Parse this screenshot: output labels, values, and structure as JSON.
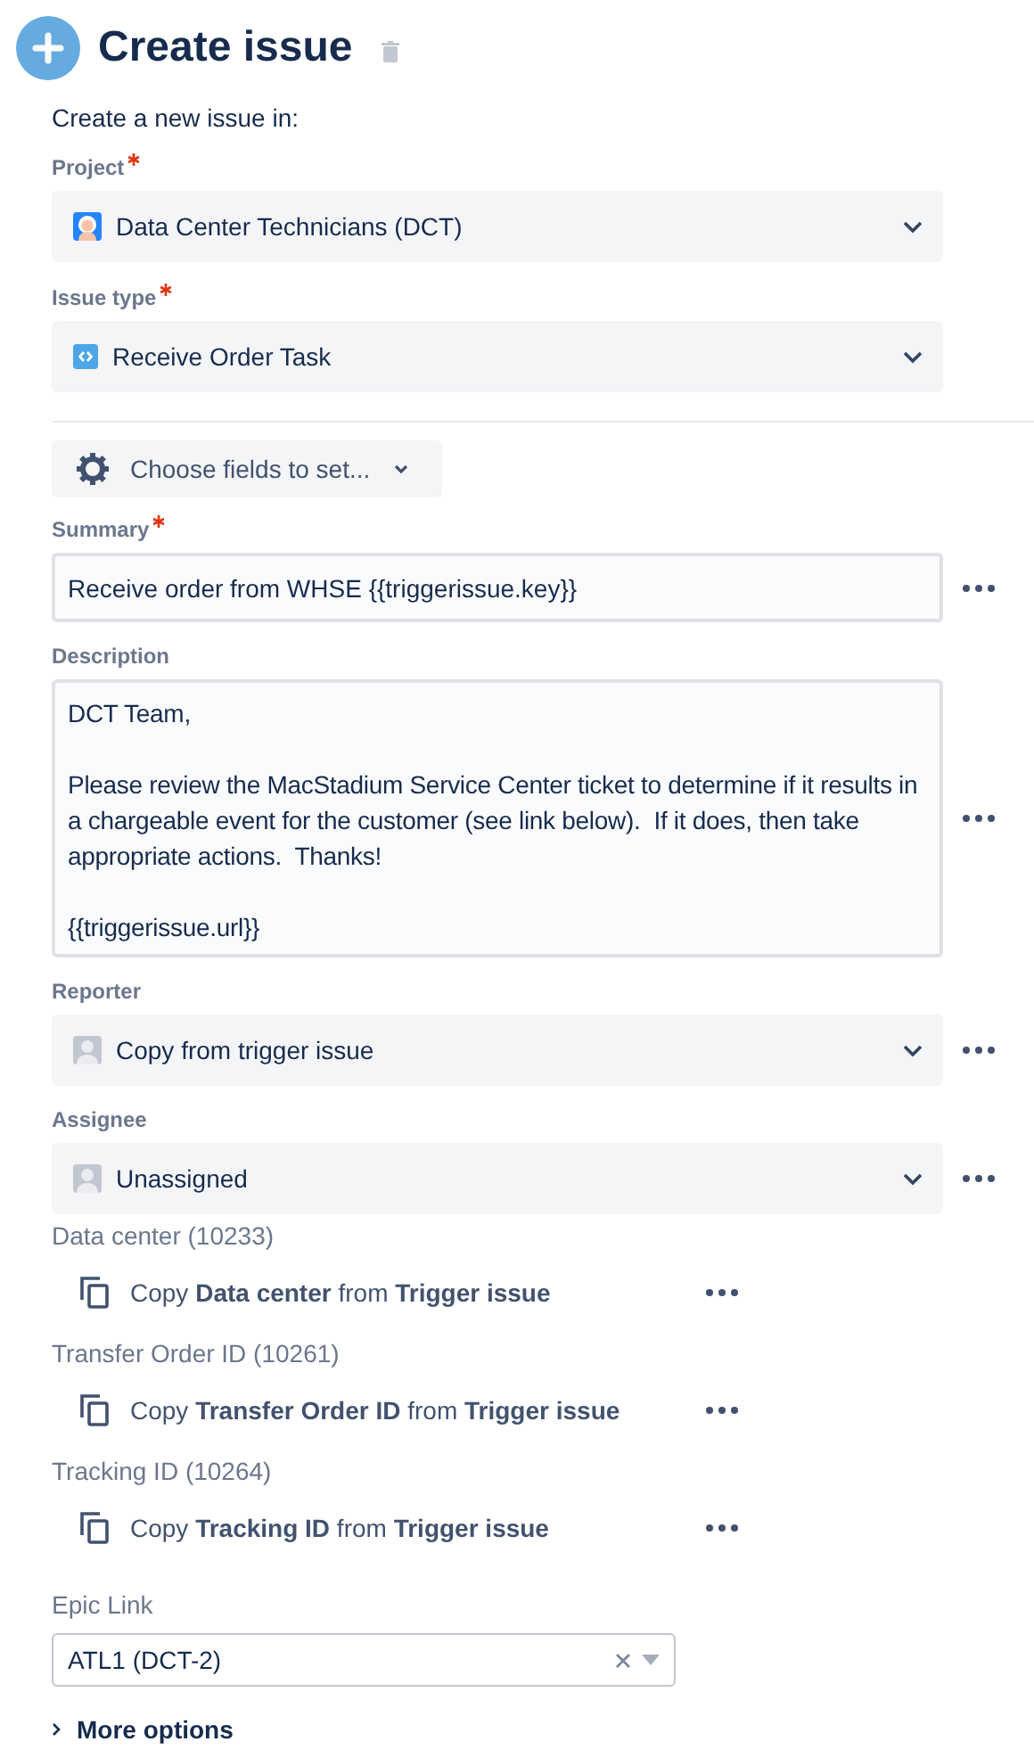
{
  "header": {
    "title": "Create issue"
  },
  "intro": "Create a new issue in:",
  "target_fields": [
    {
      "kind": "select",
      "label": "Project",
      "required": true,
      "value": "Data Center Technicians (DCT)",
      "more_actions": false
    },
    {
      "kind": "select",
      "label": "Issue type",
      "required": true,
      "value": "Receive Order Task",
      "more_actions": false
    }
  ],
  "choose_fields_button": {
    "label": "Choose fields to set..."
  },
  "fields": [
    {
      "kind": "text",
      "label": "Summary",
      "required": true,
      "value": "Receive order from WHSE {{triggerissue.key}}",
      "more_actions": true
    },
    {
      "kind": "textarea",
      "label": "Description",
      "required": false,
      "value": "DCT Team,\n\nPlease review the MacStadium Service Center ticket to determine if it results in a chargeable event for the customer (see link below).  If it does, then take appropriate actions.  Thanks!\n\n{{triggerissue.url}}",
      "more_actions": true
    },
    {
      "kind": "select",
      "label": "Reporter",
      "required": false,
      "value": "Copy from trigger issue",
      "more_actions": true
    },
    {
      "kind": "select",
      "label": "Assignee",
      "required": false,
      "value": "Unassigned",
      "more_actions": true
    },
    {
      "kind": "copy",
      "label": "Data center (10233)",
      "text": "Copy **Data center** from **Trigger issue**",
      "more_actions": true
    },
    {
      "kind": "copy",
      "label": "Transfer Order ID (10261)",
      "text": "Copy **Transfer Order ID** from **Trigger issue**",
      "more_actions": true
    },
    {
      "kind": "copy",
      "label": "Tracking ID (10264)",
      "text": "Copy **Tracking ID** from **Trigger issue**",
      "more_actions": true
    },
    {
      "kind": "combo",
      "label": "Epic Link",
      "value": "ATL1 (DCT-2)",
      "clearable": true
    }
  ],
  "more_options": {
    "label": "More options",
    "expanded": false
  }
}
